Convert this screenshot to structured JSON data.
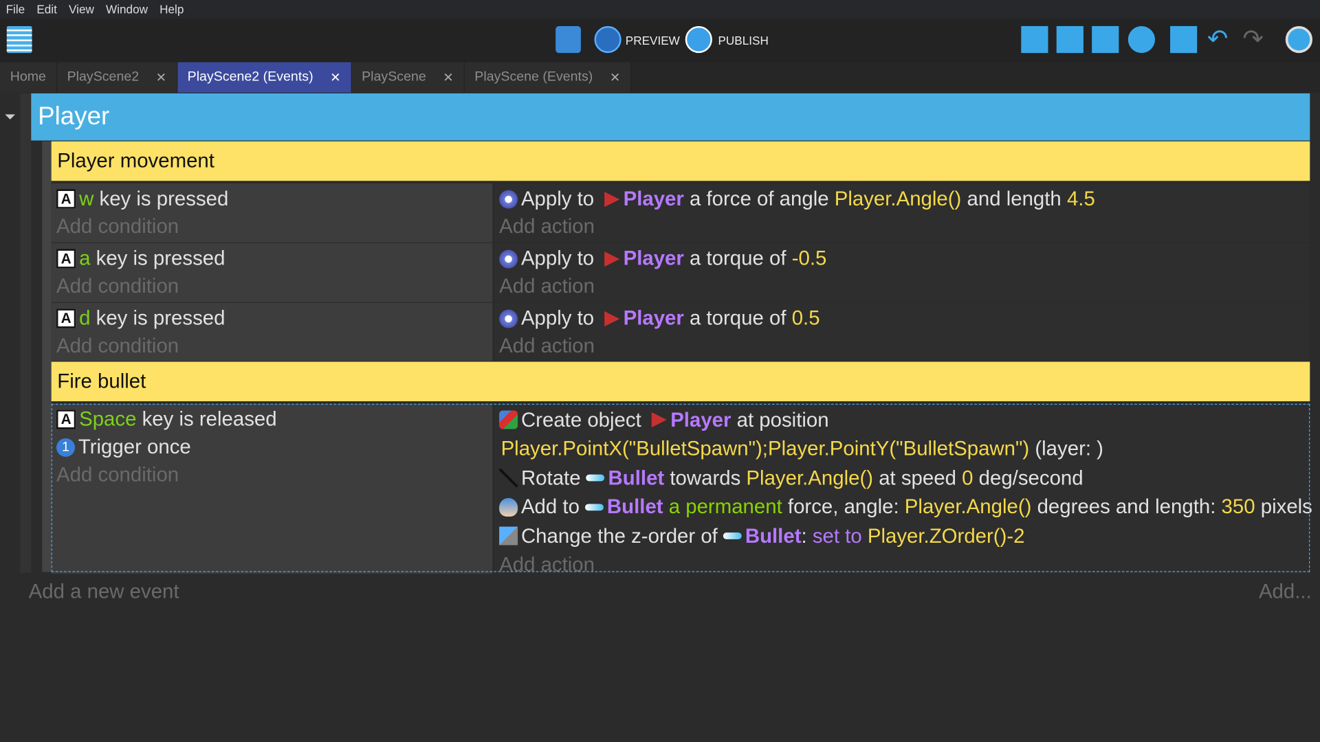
{
  "menu": [
    "File",
    "Edit",
    "View",
    "Window",
    "Help"
  ],
  "toolbar": {
    "preview_label": "PREVIEW",
    "publish_label": "PUBLISH"
  },
  "tabs": [
    {
      "label": "Home",
      "closable": false
    },
    {
      "label": "PlayScene2",
      "closable": true
    },
    {
      "label": "PlayScene2 (Events)",
      "closable": true,
      "active": true
    },
    {
      "label": "PlayScene",
      "closable": true
    },
    {
      "label": "PlayScene (Events)",
      "closable": true
    }
  ],
  "tab_close": "✕",
  "group": {
    "title": "Player",
    "color": "#49afe2"
  },
  "comments": [
    "Player movement",
    "Fire bullet"
  ],
  "placeholders": {
    "add_condition": "Add condition",
    "add_action": "Add action",
    "add_event": "Add a new event",
    "add_more": "Add..."
  },
  "events": [
    {
      "conditions": [
        {
          "icon": "key-icon",
          "segs": [
            [
              "k",
              "w"
            ],
            [
              "w",
              " key is pressed"
            ]
          ]
        }
      ],
      "actions": [
        {
          "icon": "physics-gear-icon",
          "segs": [
            [
              "w",
              "Apply to "
            ],
            [
              "obj",
              "Player"
            ],
            [
              "w",
              " a force of angle "
            ],
            [
              "p",
              "Player.Angle()"
            ],
            [
              "w",
              " and length "
            ],
            [
              "p",
              "4.5"
            ]
          ]
        }
      ]
    },
    {
      "conditions": [
        {
          "icon": "key-icon",
          "segs": [
            [
              "k",
              "a"
            ],
            [
              "w",
              " key is pressed"
            ]
          ]
        }
      ],
      "actions": [
        {
          "icon": "physics-gear-icon",
          "segs": [
            [
              "w",
              "Apply to "
            ],
            [
              "obj",
              "Player"
            ],
            [
              "w",
              " a torque of "
            ],
            [
              "p",
              "-0.5"
            ]
          ]
        }
      ]
    },
    {
      "conditions": [
        {
          "icon": "key-icon",
          "segs": [
            [
              "k",
              "d"
            ],
            [
              "w",
              " key is pressed"
            ]
          ]
        }
      ],
      "actions": [
        {
          "icon": "physics-gear-icon",
          "segs": [
            [
              "w",
              "Apply to "
            ],
            [
              "obj",
              "Player"
            ],
            [
              "w",
              " a torque of "
            ],
            [
              "p",
              "0.5"
            ]
          ]
        }
      ]
    },
    {
      "conditions": [
        {
          "icon": "key-icon",
          "segs": [
            [
              "k",
              "Space"
            ],
            [
              "w",
              " key is released"
            ]
          ]
        },
        {
          "icon": "trigger-once-icon",
          "segs": [
            [
              "w",
              "Trigger once"
            ]
          ]
        }
      ],
      "actions": [
        {
          "icon": "create-object-icon",
          "segs": [
            [
              "w",
              "Create object "
            ],
            [
              "obj",
              "Player"
            ],
            [
              "w",
              " at position"
            ]
          ]
        },
        {
          "icon": "",
          "segs": [
            [
              "p",
              "Player.PointX(\"BulletSpawn\");Player.PointY(\"BulletSpawn\")"
            ],
            [
              "w",
              " (layer: )"
            ]
          ]
        },
        {
          "icon": "rotate-icon",
          "segs": [
            [
              "w",
              "Rotate "
            ],
            [
              "bullet",
              "Bullet"
            ],
            [
              "w",
              " towards "
            ],
            [
              "p",
              "Player.Angle()"
            ],
            [
              "w",
              " at speed "
            ],
            [
              "p",
              "0"
            ],
            [
              "w",
              " deg/second"
            ]
          ]
        },
        {
          "icon": "force-icon",
          "segs": [
            [
              "w",
              "Add to "
            ],
            [
              "bullet",
              "Bullet"
            ],
            [
              "g",
              " a permanent"
            ],
            [
              "w",
              " force, angle: "
            ],
            [
              "p",
              "Player.Angle()"
            ],
            [
              "w",
              " degrees and length: "
            ],
            [
              "p",
              "350"
            ],
            [
              "w",
              " pixels"
            ]
          ]
        },
        {
          "icon": "z-order-icon",
          "segs": [
            [
              "w",
              "Change the z-order of "
            ],
            [
              "bullet",
              "Bullet"
            ],
            [
              "w",
              ": "
            ],
            [
              "v",
              "set to"
            ],
            [
              "w",
              " "
            ],
            [
              "p",
              "Player.ZOrder()-2"
            ]
          ]
        }
      ]
    }
  ]
}
